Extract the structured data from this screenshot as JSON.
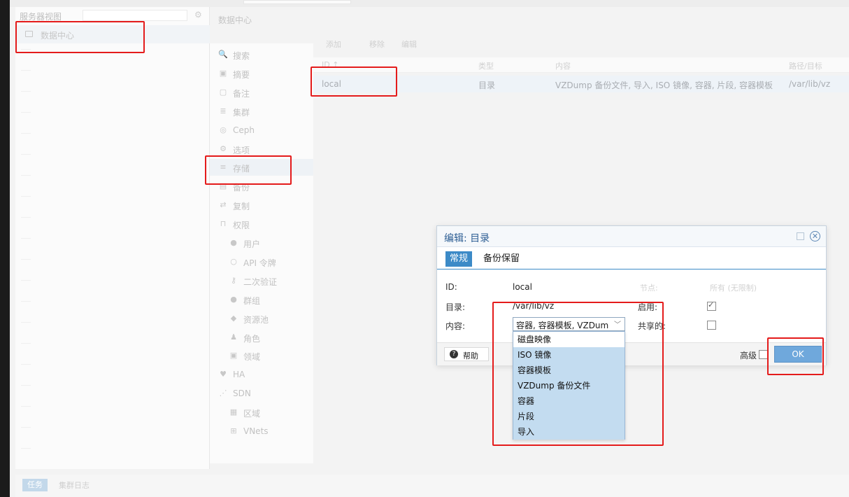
{
  "tree": {
    "title": "服务器视图",
    "root_label": "数据中心"
  },
  "breadcrumb": "数据中心",
  "nav": [
    {
      "icon": "search-icon",
      "label": "搜索",
      "sub": false,
      "active": false
    },
    {
      "icon": "summary-icon",
      "label": "摘要",
      "sub": false,
      "active": false
    },
    {
      "icon": "notes-icon",
      "label": "备注",
      "sub": false,
      "active": false
    },
    {
      "icon": "cluster-icon",
      "label": "集群",
      "sub": false,
      "active": false
    },
    {
      "icon": "ceph-icon",
      "label": "Ceph",
      "sub": false,
      "active": false
    },
    {
      "icon": "gear-icon",
      "label": "选项",
      "sub": false,
      "active": false
    },
    {
      "icon": "database-icon",
      "label": "存储",
      "sub": false,
      "active": true
    },
    {
      "icon": "floppy-icon",
      "label": "备份",
      "sub": false,
      "active": false
    },
    {
      "icon": "retweet-icon",
      "label": "复制",
      "sub": false,
      "active": false
    },
    {
      "icon": "unlock-icon",
      "label": "权限",
      "sub": false,
      "active": false
    },
    {
      "icon": "user-icon",
      "label": "用户",
      "sub": true,
      "active": false
    },
    {
      "icon": "user-outline-icon",
      "label": "API 令牌",
      "sub": true,
      "active": false
    },
    {
      "icon": "key-icon",
      "label": "二次验证",
      "sub": true,
      "active": false
    },
    {
      "icon": "users-icon",
      "label": "群组",
      "sub": true,
      "active": false
    },
    {
      "icon": "tags-icon",
      "label": "资源池",
      "sub": true,
      "active": false
    },
    {
      "icon": "male-icon",
      "label": "角色",
      "sub": true,
      "active": false
    },
    {
      "icon": "address-book-icon",
      "label": "领域",
      "sub": true,
      "active": false
    },
    {
      "icon": "heartbeat-icon",
      "label": "HA",
      "sub": false,
      "active": false
    },
    {
      "icon": "sdn-icon",
      "label": "SDN",
      "sub": false,
      "active": false
    },
    {
      "icon": "th-icon",
      "label": "区域",
      "sub": true,
      "active": false
    },
    {
      "icon": "sitemap-icon",
      "label": "VNets",
      "sub": true,
      "active": false
    }
  ],
  "toolbar": {
    "add": "添加",
    "remove": "移除",
    "edit": "编辑"
  },
  "grid": {
    "columns": [
      "ID ↑",
      "类型",
      "内容",
      "路径/目标"
    ],
    "rows": [
      {
        "id": "local",
        "type": "目录",
        "content": "VZDump 备份文件, 导入, ISO 镜像, 容器, 片段, 容器模板",
        "path": "/var/lib/vz"
      }
    ]
  },
  "bottom": {
    "tasks": "任务",
    "cluster_log": "集群日志"
  },
  "dialog": {
    "title": "编辑: 目录",
    "tabs": [
      "常规",
      "备份保留"
    ],
    "fields": {
      "id_label": "ID:",
      "id_value": "local",
      "dir_label": "目录:",
      "dir_value": "/var/lib/vz",
      "content_label": "内容:",
      "content_value": "容器, 容器模板, VZDum",
      "nodes_label": "节点:",
      "nodes_value": "所有 (无限制)",
      "enable_label": "启用:",
      "enable_checked": true,
      "shared_label": "共享的:",
      "shared_checked": false
    },
    "help": "帮助",
    "advanced": "高级",
    "ok": "OK"
  },
  "dropdown": {
    "options": [
      {
        "label": "磁盘映像",
        "selected": false
      },
      {
        "label": "ISO 镜像",
        "selected": true
      },
      {
        "label": "容器模板",
        "selected": true
      },
      {
        "label": "VZDump 备份文件",
        "selected": true
      },
      {
        "label": "容器",
        "selected": true
      },
      {
        "label": "片段",
        "selected": true
      },
      {
        "label": "导入",
        "selected": true
      }
    ]
  },
  "colors": {
    "accent": "#3c8ac7",
    "annotation": "#e41b1b",
    "selected_option": "#c3dcf0"
  }
}
